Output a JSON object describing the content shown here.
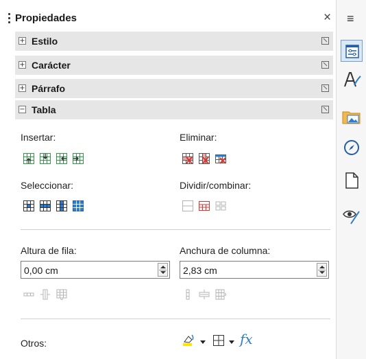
{
  "panel": {
    "title": "Propiedades",
    "close_symbol": "×"
  },
  "tabbar": {
    "menu_symbol": "≡"
  },
  "sections": [
    {
      "label": "Estilo",
      "expanded": false,
      "toggle": "+"
    },
    {
      "label": "Carácter",
      "expanded": false,
      "toggle": "+"
    },
    {
      "label": "Párrafo",
      "expanded": false,
      "toggle": "+"
    },
    {
      "label": "Tabla",
      "expanded": true,
      "toggle": "−"
    }
  ],
  "table": {
    "insert_label": "Insertar:",
    "delete_label": "Eliminar:",
    "select_label": "Seleccionar:",
    "split_merge_label": "Dividir/combinar:",
    "row_height_label": "Altura de fila:",
    "row_height_value": "0,00 cm",
    "col_width_label": "Anchura de columna:",
    "col_width_value": "2,83 cm",
    "other_label": "Otros:",
    "formula_symbol": "fx"
  },
  "colors": {
    "section_bg": "#e6e6e6",
    "accent_blue": "#2b7cd3",
    "insert_green": "#2e9a45",
    "delete_red": "#e0312d",
    "tab_selected": "#dbe8f6"
  }
}
